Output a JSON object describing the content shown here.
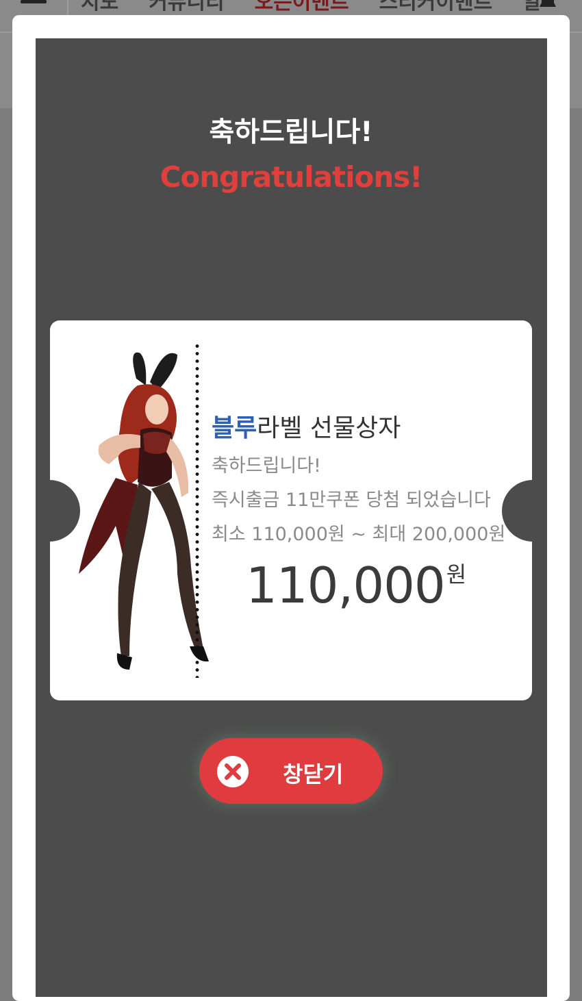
{
  "header": {
    "nav_items": [
      "지도",
      "커뮤니티",
      "오픈이벤트",
      "스티커이벤트",
      "알"
    ],
    "active_index": 2
  },
  "modal": {
    "title_ko": "축하드립니다!",
    "title_en": "Congratulations!",
    "card": {
      "label_accent": "블루",
      "label_rest": "라벨 선물상자",
      "line1": "축하드립니다!",
      "line2": "즉시출금 11만쿠폰 당첨 되었습니다",
      "line3": "최소 110,000원 ~ 최대 200,000원",
      "amount": "110,000",
      "amount_unit": "원"
    },
    "close_label": "창닫기"
  },
  "colors": {
    "accent_red": "#e03c3f",
    "accent_blue": "#2e5fb3",
    "modal_bg": "#4c4c4c"
  },
  "icons": {
    "menu": "hamburger-menu-icon",
    "bell": "bell-icon",
    "close": "close-x-icon"
  }
}
